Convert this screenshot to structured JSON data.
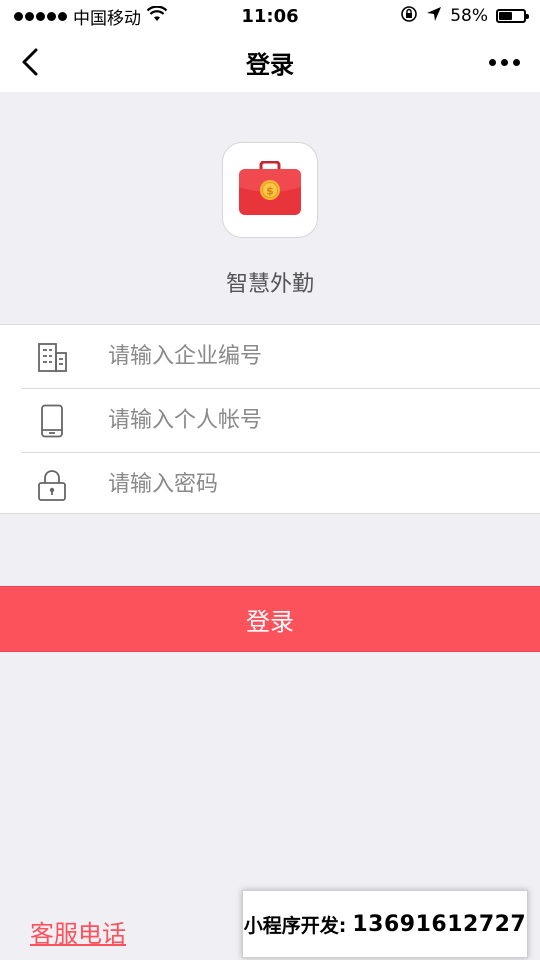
{
  "status_bar": {
    "carrier": "中国移动",
    "time": "11:06",
    "battery": "58%",
    "battery_level": 0.58,
    "icons": [
      "signal-dots",
      "wifi-icon",
      "orientation-lock-icon",
      "location-arrow-icon",
      "battery-icon"
    ]
  },
  "nav": {
    "title": "登录",
    "back_icon": "chevron-left-icon",
    "more_icon": "more-dots-icon"
  },
  "app": {
    "name": "智慧外勤",
    "icon": "briefcase-coin-icon",
    "icon_color": "#e8353c",
    "coin_color": "#f7b731"
  },
  "form": {
    "company": {
      "placeholder": "请输入企业编号",
      "icon": "building-icon"
    },
    "account": {
      "placeholder": "请输入个人帐号",
      "icon": "phone-icon"
    },
    "password": {
      "placeholder": "请输入密码",
      "icon": "lock-icon"
    }
  },
  "login_button": {
    "label": "登录",
    "color": "#fc525c"
  },
  "service_link": "客服电话",
  "dev_banner": {
    "label": "小程序开发:",
    "phone": "13691612727"
  }
}
